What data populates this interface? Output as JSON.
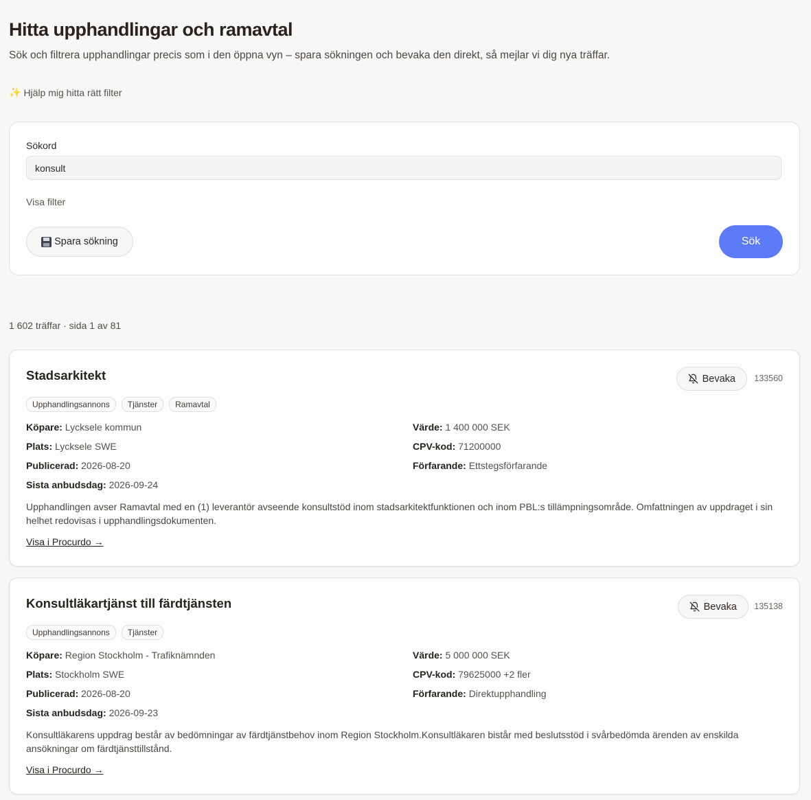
{
  "header": {
    "title": "Hitta upphandlingar och ramavtal",
    "subtitle": "Sök och filtrera upphandlingar precis som i den öppna vyn – spara sökningen och bevaka den direkt, så mejlar vi dig nya träffar.",
    "help_icon": "sparkle-icon",
    "help_label": "Hjälp mig hitta rätt filter"
  },
  "search": {
    "label": "Sökord",
    "value": "konsult",
    "show_filters": "Visa filter",
    "save_icon": "floppy-disk-icon",
    "save_label": "Spara sökning",
    "submit_label": "Sök",
    "accent_color": "#5b7cf6"
  },
  "results": {
    "summary": "1 602 träffar · sida 1 av 81",
    "items": [
      {
        "title": "Stadsarkitekt",
        "watch_label": "Bevaka",
        "id": "133560",
        "tags": [
          "Upphandlingsannons",
          "Tjänster",
          "Ramavtal"
        ],
        "buyer_label": "Köpare:",
        "buyer": "Lycksele kommun",
        "place_label": "Plats:",
        "place": "Lycksele SWE",
        "published_label": "Publicerad:",
        "published": "2026-08-20",
        "deadline_label": "Sista anbudsdag:",
        "deadline": "2026-09-24",
        "value_label": "Värde:",
        "value": "1 400 000 SEK",
        "cpv_label": "CPV-kod:",
        "cpv": "71200000",
        "procedure_label": "Förfarande:",
        "procedure": "Ettstegsförfarande",
        "description": "Upphandlingen avser Ramavtal med en (1) leverantör avseende konsultstöd inom stadsarkitektfunktionen och inom PBL:s tillämpningsområde. Omfattningen av uppdraget i sin helhet redovisas i upphandlingsdokumenten.",
        "link": "Visa i Procurdo →"
      },
      {
        "title": "Konsultläkartjänst till färdtjänsten",
        "watch_label": "Bevaka",
        "id": "135138",
        "tags": [
          "Upphandlingsannons",
          "Tjänster"
        ],
        "buyer_label": "Köpare:",
        "buyer": "Region Stockholm - Trafiknämnden",
        "place_label": "Plats:",
        "place": "Stockholm SWE",
        "published_label": "Publicerad:",
        "published": "2026-08-20",
        "deadline_label": "Sista anbudsdag:",
        "deadline": "2026-09-23",
        "value_label": "Värde:",
        "value": "5 000 000 SEK",
        "cpv_label": "CPV-kod:",
        "cpv": "79625000 +2 fler",
        "procedure_label": "Förfarande:",
        "procedure": "Direktupphandling",
        "description": "Konsultläkarens uppdrag består av bedömningar av färdtjänstbehov inom Region Stockholm.Konsultläkaren bistår med beslutsstöd i svårbedömda ärenden av enskilda ansökningar om färdtjänsttillstånd.",
        "link": "Visa i Procurdo →"
      }
    ]
  }
}
